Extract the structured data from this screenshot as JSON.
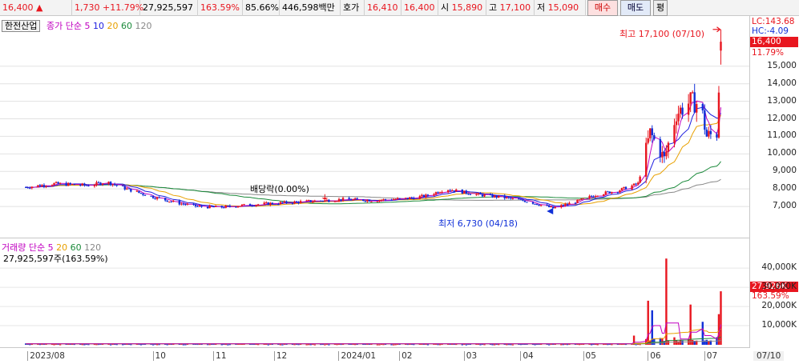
{
  "quote_bar": {
    "price": "16,400",
    "arrow": "▲",
    "change": "1,730",
    "change_pct": "+11.79%",
    "volume": "27,925,597",
    "vol_ratio": "163.59%",
    "turnover": "85.66%",
    "value": "446,598백만",
    "hoga_label": "호가",
    "ask": "16,410",
    "bid": "16,400",
    "open_label": "시",
    "open": "15,890",
    "high_label": "고",
    "high": "17,100",
    "low_label": "저",
    "low": "15,090",
    "buy_label": "매수",
    "sell_label": "매도",
    "avg_label": "평"
  },
  "price_panel": {
    "stock_name": "한전산업",
    "legend": {
      "prefix": "종가 단순",
      "ma5": "5",
      "ma10": "10",
      "ma20": "20",
      "ma60": "60",
      "ma120": "120"
    },
    "lc": "LC:143.68",
    "hc": "HC:-4.09",
    "last_price_tag": "16,400",
    "last_pct_tag": "11.79%",
    "high_annotation": "최고 17,100 (07/10)",
    "low_annotation": "최저 6,730 (04/18)",
    "dividend_annotation": "배당락(0.00%)"
  },
  "volume_panel": {
    "legend": {
      "prefix": "거래량 단순",
      "ma5": "5",
      "ma20": "20",
      "ma60": "60",
      "ma120": "120"
    },
    "volume_text": "27,925,597주(163.59%)",
    "last_vol_tag": "27,926K",
    "last_vol_pct_tag": "163.59%"
  },
  "colors": {
    "up": "#e8161f",
    "down": "#1030d8",
    "ma5": "#c000c0",
    "ma10": "#1c1ce0",
    "ma20": "#e8a000",
    "ma60": "#1a8a3a",
    "ma120": "#888888"
  },
  "chart_data": [
    {
      "type": "candlestick",
      "title": "한전산업",
      "x_ticks": [
        "2023/08",
        "10",
        "11",
        "12",
        "2024/01",
        "02",
        "03",
        "04",
        "05",
        "06",
        "07",
        "07/10"
      ],
      "y_ticks": [
        7000,
        8000,
        9000,
        10000,
        11000,
        12000,
        13000,
        14000,
        15000
      ],
      "ylim": [
        6000,
        17500
      ],
      "last": {
        "open": 15890,
        "high": 17100,
        "low": 15090,
        "close": 16400
      },
      "max_point": {
        "date": "07/10",
        "value": 17100
      },
      "min_point": {
        "date": "04/18",
        "value": 6730
      },
      "close_path": [
        [
          "2023-08-01",
          8100
        ],
        [
          "2023-08-15",
          8300
        ],
        [
          "2023-09-01",
          8200
        ],
        [
          "2023-09-10",
          8400
        ],
        [
          "2023-09-20",
          8000
        ],
        [
          "2023-10-01",
          7600
        ],
        [
          "2023-10-15",
          7200
        ],
        [
          "2023-10-25",
          7000
        ],
        [
          "2023-11-05",
          6950
        ],
        [
          "2023-11-20",
          7100
        ],
        [
          "2023-12-05",
          7200
        ],
        [
          "2023-12-20",
          7300
        ],
        [
          "2024-01-05",
          7400
        ],
        [
          "2024-01-20",
          7350
        ],
        [
          "2024-02-05",
          7450
        ],
        [
          "2024-02-15",
          7600
        ],
        [
          "2024-02-25",
          8000
        ],
        [
          "2024-03-10",
          7700
        ],
        [
          "2024-03-25",
          7500
        ],
        [
          "2024-04-05",
          7300
        ],
        [
          "2024-04-18",
          6900
        ],
        [
          "2024-04-30",
          7300
        ],
        [
          "2024-05-10",
          7700
        ],
        [
          "2024-05-20",
          7900
        ],
        [
          "2024-05-30",
          8300
        ],
        [
          "2024-06-05",
          11200
        ],
        [
          "2024-06-12",
          9700
        ],
        [
          "2024-06-18",
          12300
        ],
        [
          "2024-06-25",
          13000
        ],
        [
          "2024-06-30",
          12800
        ],
        [
          "2024-07-03",
          11000
        ],
        [
          "2024-07-08",
          11200
        ],
        [
          "2024-07-10",
          16400
        ]
      ]
    },
    {
      "type": "bar",
      "title": "거래량",
      "y_ticks_label": [
        "10,000K",
        "20,000K",
        "30,000K",
        "40,000K"
      ],
      "ylim": [
        0,
        48000
      ],
      "peaks": [
        [
          "2024-05-28",
          4800
        ],
        [
          "2024-06-04",
          23000
        ],
        [
          "2024-06-06",
          18000
        ],
        [
          "2024-06-13",
          45000
        ],
        [
          "2024-06-25",
          21000
        ],
        [
          "2024-07-01",
          12000
        ],
        [
          "2024-07-09",
          16000
        ],
        [
          "2024-07-10",
          27926
        ]
      ]
    }
  ]
}
